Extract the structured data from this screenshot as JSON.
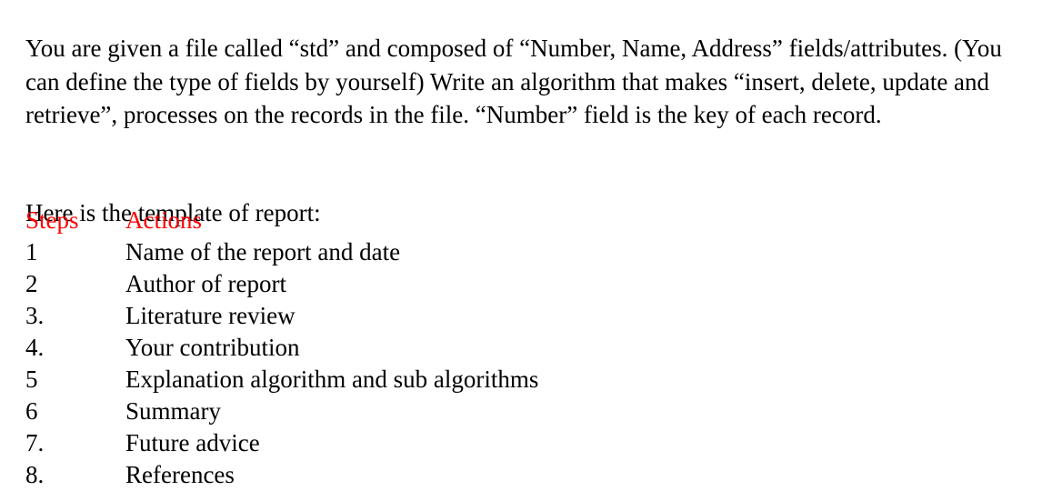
{
  "document": {
    "intro_paragraph": "You are given a file called “std” and composed of “Number, Name, Address” fields/attributes. (You can define the type of fields by yourself) Write an algorithm that makes “insert, delete, update and retrieve”, processes on the records in the file. “Number” field is the key of each record.",
    "lead_in": "Here is the template of report:",
    "table": {
      "header": {
        "step": "Steps",
        "action": "Actions",
        "color": "#ff0000"
      },
      "rows": [
        {
          "step": "1",
          "action": "Name of the report and date"
        },
        {
          "step": "2",
          "action": "Author of report"
        },
        {
          "step": "3.",
          "action": "Literature review"
        },
        {
          "step": "4.",
          "action": "Your contribution"
        },
        {
          "step": "5",
          "action": "Explanation algorithm and sub algorithms"
        },
        {
          "step": "6",
          "action": "Summary"
        },
        {
          "step": "7.",
          "action": "Future advice"
        },
        {
          "step": "8.",
          "action": "References"
        }
      ]
    },
    "colors": {
      "text": "#000000",
      "accent": "#ff0000",
      "background": "#ffffff"
    }
  }
}
